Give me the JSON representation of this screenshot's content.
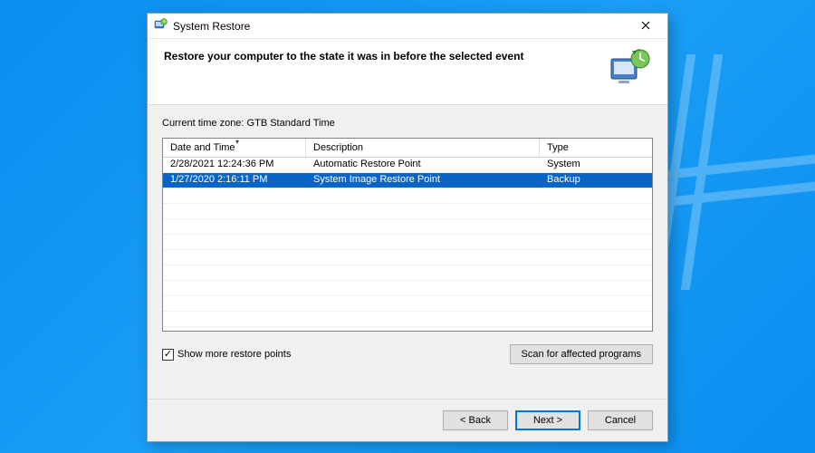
{
  "titlebar": {
    "title": "System Restore"
  },
  "header": {
    "heading": "Restore your computer to the state it was in before the selected event"
  },
  "body": {
    "timezone_label": "Current time zone: GTB Standard Time",
    "columns": {
      "date_time": "Date and Time",
      "description": "Description",
      "type": "Type"
    },
    "rows": [
      {
        "date_time": "2/28/2021 12:24:36 PM",
        "description": "Automatic Restore Point",
        "type": "System",
        "selected": false
      },
      {
        "date_time": "1/27/2020 2:16:11 PM",
        "description": "System Image Restore Point",
        "type": "Backup",
        "selected": true
      }
    ],
    "checkbox": {
      "label": "Show more restore points",
      "checked": true
    },
    "scan_button": "Scan for affected programs"
  },
  "footer": {
    "back": "< Back",
    "next": "Next >",
    "cancel": "Cancel"
  }
}
